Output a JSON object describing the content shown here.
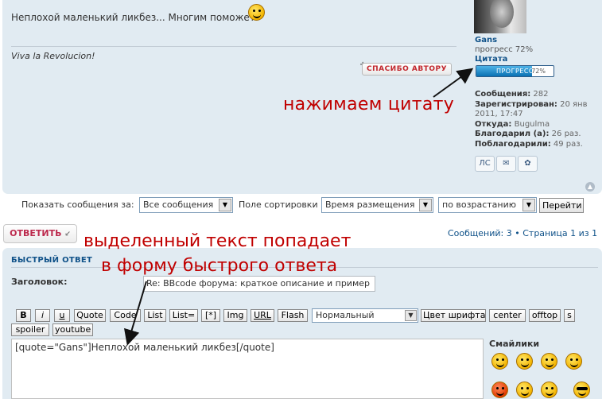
{
  "post": {
    "text": "Неплохой маленький ликбез... Многим поможет",
    "signature": "Viva la Revolucion!",
    "thanks_label": "СПАСИБО АВТОРУ",
    "smile_icon": "smile-icon"
  },
  "profile": {
    "name": "Gans",
    "progress_text": "прогресс 72%",
    "rank": "Цитата",
    "bar": {
      "label": "ПРОГРЕСС",
      "pct_label": "72%",
      "fraction": 0.72
    },
    "stats": [
      {
        "label": "Сообщения:",
        "value": "282"
      },
      {
        "label": "Зарегистрирован:",
        "value": "20 янв"
      },
      {
        "label": "",
        "value": "2011, 17:47"
      },
      {
        "label": "Откуда:",
        "value": "Bugulma"
      },
      {
        "label": "Благодарил (а):",
        "value": "26 раз."
      },
      {
        "label": "Поблагодарили:",
        "value": "49 раз."
      }
    ],
    "icons": {
      "pm": "ЛС",
      "email": "✉",
      "icq": "✿"
    }
  },
  "annotations": {
    "quote_hint": "нажимаем цитату",
    "selection_hint_line1": "выделенный текст попадает",
    "selection_hint_line2": "в форму быстрого ответа"
  },
  "filter": {
    "show_label": "Показать сообщения за:",
    "show_value": "Все сообщения",
    "sort_label": "Поле сортировки",
    "sort_value": "Время размещения",
    "order_value": "по возрастанию",
    "go_label": "Перейти"
  },
  "reply": {
    "button_label": "ОТВЕТИТЬ",
    "pagination": "Сообщений: 3 • Страница 1 из 1"
  },
  "quick_reply": {
    "title": "БЫСТРЫЙ ОТВЕТ",
    "subject_label": "Заголовок:",
    "subject_value": "Re: BBcode форума: краткое описание и пример",
    "toolbar": [
      "B",
      "i",
      "u",
      "Quote",
      "Code",
      "List",
      "List=",
      "[*]",
      "Img",
      "URL",
      "Flash"
    ],
    "size_value": "Нормальный",
    "toolbar2": [
      "Цвет шрифта",
      "center",
      "offtop",
      "s"
    ],
    "toolbar3": [
      "spoiler",
      "youtube"
    ],
    "textarea_value": "[quote=\"Gans\"]Неплохой маленький ликбез[/quote]",
    "smilies_title": "Смайлики"
  },
  "colors": {
    "accent": "#c00000",
    "panel": "#e1ebf2",
    "link": "#105289"
  }
}
